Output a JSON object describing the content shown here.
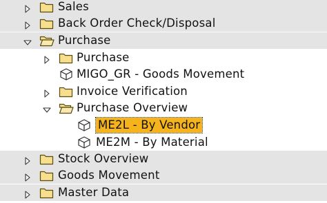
{
  "tree": {
    "items": [
      {
        "label": "Sales",
        "kind": "folder",
        "state": "collapsed",
        "level": 0
      },
      {
        "label": "Back Order Check/Disposal",
        "kind": "folder",
        "state": "collapsed",
        "level": 0
      },
      {
        "label": "Purchase",
        "kind": "folder-open",
        "state": "expanded",
        "level": 0
      },
      {
        "label": "Purchase",
        "kind": "folder",
        "state": "collapsed",
        "level": 1
      },
      {
        "label": "MIGO_GR - Goods Movement",
        "kind": "transaction",
        "state": "leaf",
        "level": 1
      },
      {
        "label": "Invoice Verification",
        "kind": "folder",
        "state": "collapsed",
        "level": 1
      },
      {
        "label": "Purchase Overview",
        "kind": "folder-open",
        "state": "expanded",
        "level": 1
      },
      {
        "label": "ME2L - By Vendor",
        "kind": "transaction",
        "state": "leaf",
        "level": 2,
        "selected": true
      },
      {
        "label": "ME2M - By Material",
        "kind": "transaction",
        "state": "leaf",
        "level": 2
      },
      {
        "label": "Stock Overview",
        "kind": "folder",
        "state": "collapsed",
        "level": 0
      },
      {
        "label": "Goods Movement",
        "kind": "folder",
        "state": "collapsed",
        "level": 0
      },
      {
        "label": "Master Data",
        "kind": "folder",
        "state": "collapsed",
        "level": 0
      }
    ],
    "colors": {
      "selection": "#f7b31b",
      "shaded_row": "#e4e4e4",
      "folder_fill": "#f6df8d",
      "folder_stroke": "#5a4a10"
    }
  }
}
